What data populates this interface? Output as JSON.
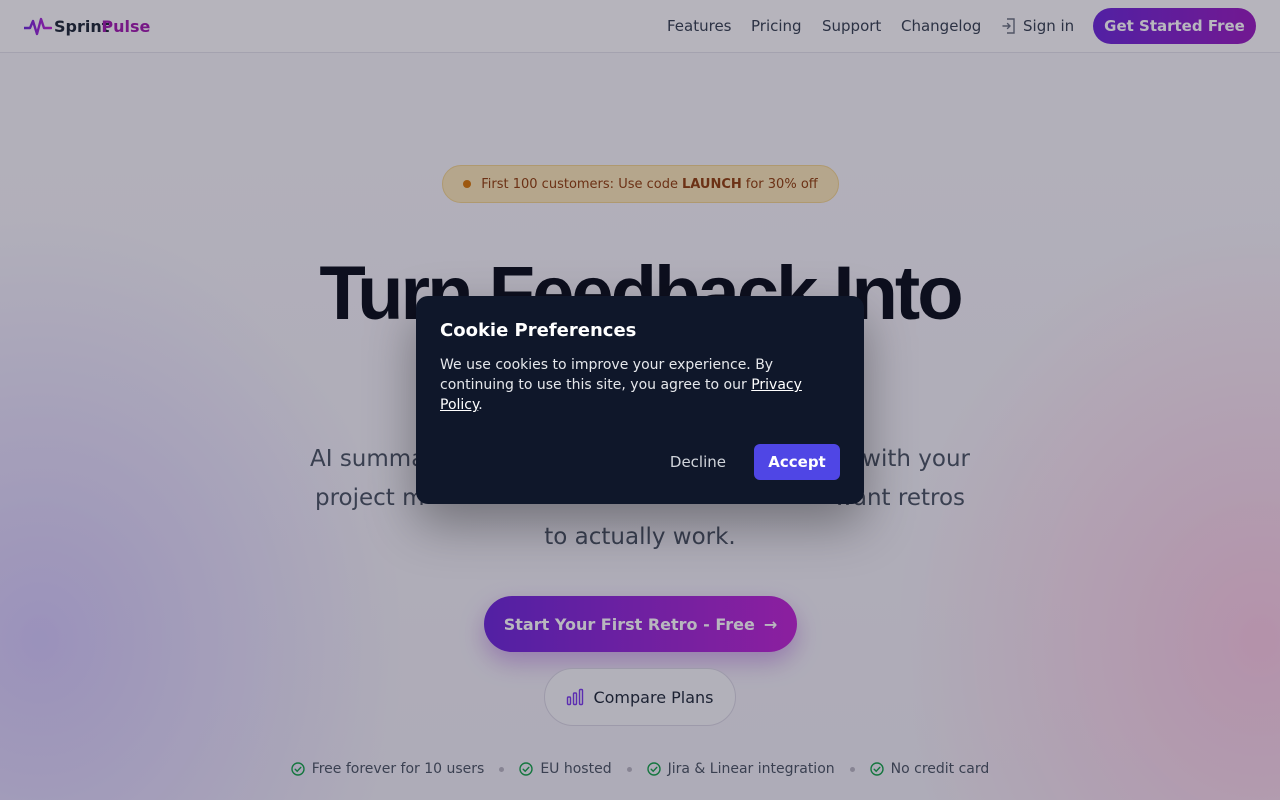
{
  "brand": {
    "name_part1": "Sprint",
    "name_part2": "Pulse"
  },
  "nav": {
    "links": [
      "Features",
      "Pricing",
      "Support",
      "Changelog"
    ],
    "sign_in": "Sign in",
    "cta": "Get Started Free"
  },
  "promo": {
    "text_before": "First 100 customers: Use code",
    "code": "LAUNCH",
    "text_after": "for 30% off"
  },
  "hero": {
    "title": "Turn Feedback Into",
    "subtitle": "AI summa… with your project management tools. Built for teams that want retros to actually work.",
    "subtitle_visible_line1": "AI summa",
    "subtitle_visible_line1_end": "with your",
    "subtitle_line2_start": "project m",
    "subtitle_line2_end": "want retros",
    "subtitle_line3": "to actually work.",
    "primary_cta": "Start Your First Retro - Free",
    "secondary_cta": "Compare Plans"
  },
  "trust": [
    "Free forever for 10 users",
    "EU hosted",
    "Jira & Linear integration",
    "No credit card"
  ],
  "cookie_modal": {
    "title": "Cookie Preferences",
    "body_before_link": "We use cookies to improve your experience. By continuing to use this site, you agree to our",
    "link_text": "Privacy Policy",
    "body_after_link": ".",
    "decline_label": "Decline",
    "accept_label": "Accept"
  },
  "colors": {
    "brand_purple": "#6d28d9",
    "brand_magenta": "#c026d3",
    "accept_button": "#4f46e5",
    "modal_bg": "#0f172a",
    "check_green": "#16a34a"
  }
}
